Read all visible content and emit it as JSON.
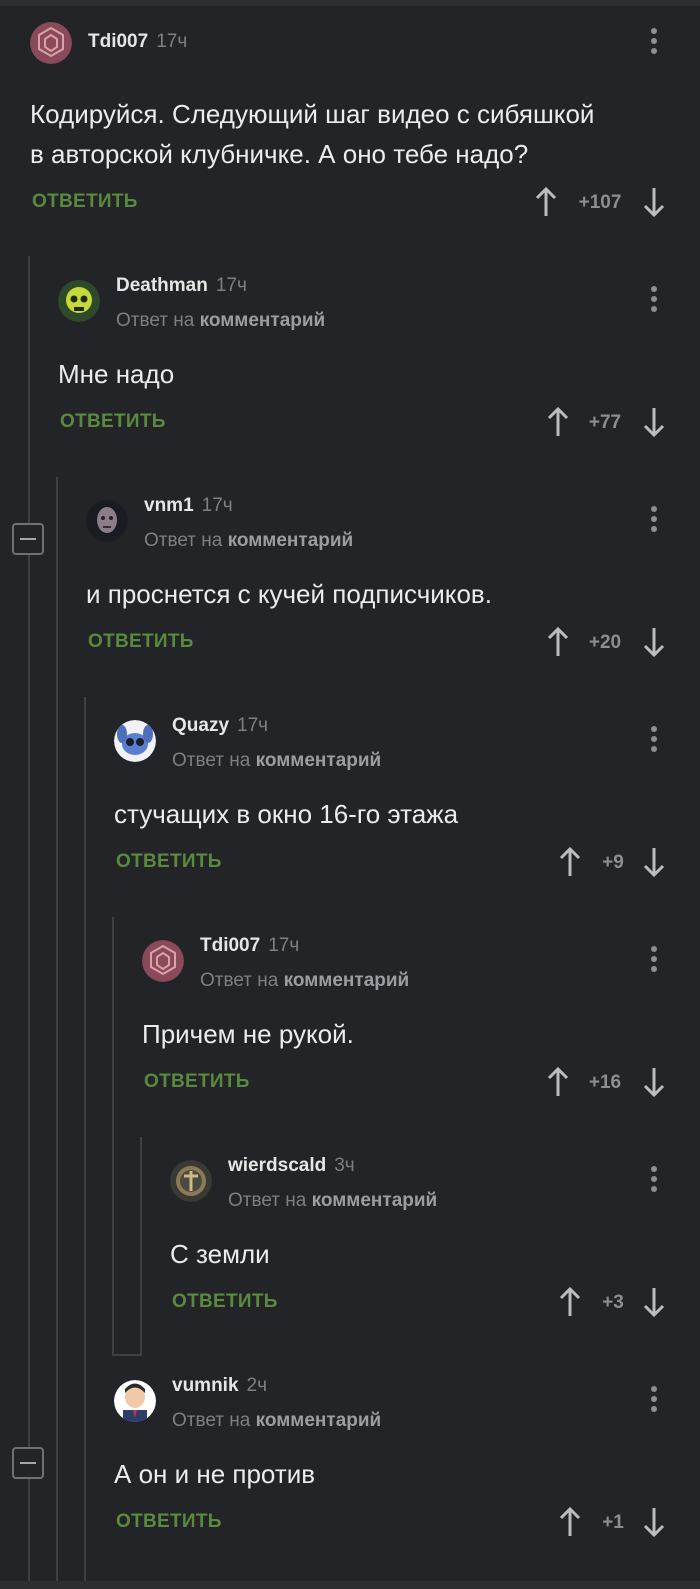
{
  "reply_button_label": "ОТВЕТИТЬ",
  "reply_to_prefix": "Ответ на",
  "reply_to_link": "комментарий",
  "colors": {
    "background": "#222427",
    "accent_green": "#5a8a3e",
    "muted": "#7c8085"
  },
  "comments": [
    {
      "author": "Tdi007",
      "time": "17ч",
      "text": "Кодируйся. Следующий шаг видео с сибяшкой",
      "text_line2": "в авторской клубничке. А оно тебе надо?",
      "score": "+107",
      "avatar_icon": "hexagon-pattern-avatar"
    },
    {
      "author": "Deathman",
      "time": "17ч",
      "text": "Мне надо",
      "score": "+77",
      "avatar_icon": "green-skull-avatar"
    },
    {
      "author": "vnm1",
      "time": "17ч",
      "text": "и проснется с кучей подписчиков.",
      "score": "+20",
      "avatar_icon": "dark-face-avatar"
    },
    {
      "author": "Quazy",
      "time": "17ч",
      "text": "стучащих в окно 16-го этажа",
      "score": "+9",
      "avatar_icon": "stitch-avatar"
    },
    {
      "author": "Tdi007",
      "time": "17ч",
      "text": "Причем не рукой.",
      "score": "+16",
      "avatar_icon": "hexagon-pattern-avatar"
    },
    {
      "author": "wierdscald",
      "time": "3ч",
      "text": "С земли",
      "score": "+3",
      "avatar_icon": "cross-emblem-avatar"
    },
    {
      "author": "vumnik",
      "time": "2ч",
      "text": "А он и не против",
      "score": "+1",
      "avatar_icon": "cartoon-man-avatar"
    }
  ]
}
